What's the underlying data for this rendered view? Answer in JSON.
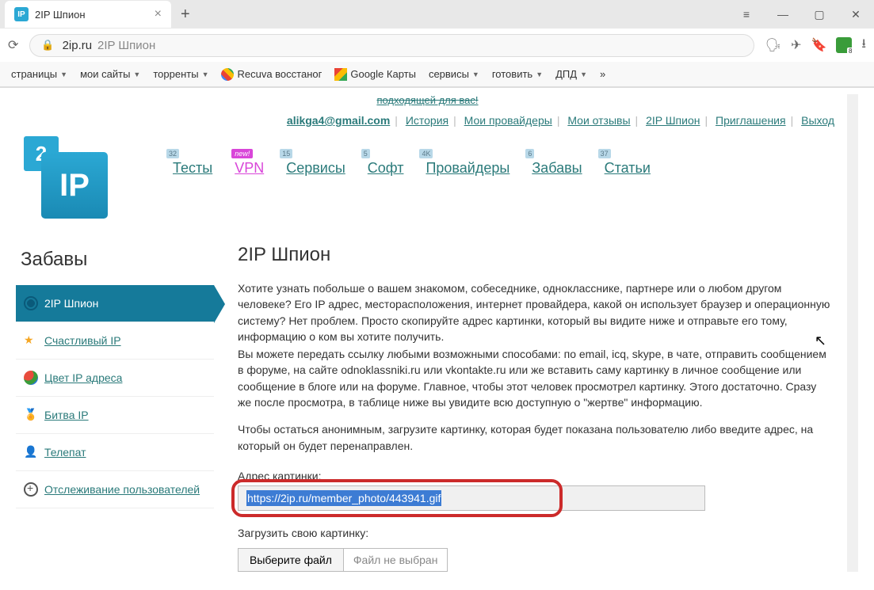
{
  "browser": {
    "tab_title": "2IP Шпион",
    "tab_favicon_text": "IP",
    "url_domain": "2ip.ru",
    "url_path": "2IP Шпион",
    "shield_badge": "8"
  },
  "bookmarks": [
    {
      "label": "страницы",
      "dropdown": true
    },
    {
      "label": "мои сайты",
      "dropdown": true
    },
    {
      "label": "торренты",
      "dropdown": true
    },
    {
      "label": "Recuva восстаног",
      "icon": "google"
    },
    {
      "label": "Google Карты",
      "icon": "maps"
    },
    {
      "label": "сервисы",
      "dropdown": true
    },
    {
      "label": "готовить",
      "dropdown": true
    },
    {
      "label": "ДПД",
      "dropdown": true
    }
  ],
  "top_cut": "подходящей для вас!",
  "user_bar": {
    "email": "alikga4@gmail.com",
    "links": [
      "История",
      "Мои провайдеры",
      "Мои отзывы",
      "2IP Шпион",
      "Приглашения",
      "Выход"
    ]
  },
  "logo": {
    "small": "2",
    "big": "IP"
  },
  "main_nav": [
    {
      "label": "Тесты",
      "badge": "32"
    },
    {
      "label": "VPN",
      "new": "new!"
    },
    {
      "label": "Сервисы",
      "badge": "15"
    },
    {
      "label": "Софт",
      "badge": "5"
    },
    {
      "label": "Провайдеры",
      "badge": "4K"
    },
    {
      "label": "Забавы",
      "badge": "6"
    },
    {
      "label": "Статьи",
      "badge": "37"
    }
  ],
  "sidebar": {
    "title": "Забавы",
    "items": [
      {
        "label": "2IP Шпион",
        "active": true
      },
      {
        "label": "Счастливый IP"
      },
      {
        "label": "Цвет IP адреса"
      },
      {
        "label": "Битва IP"
      },
      {
        "label": "Телепат"
      },
      {
        "label": "Отслеживание пользователей"
      }
    ]
  },
  "main": {
    "title": "2IP Шпион",
    "p1": "Хотите узнать побольше о вашем знакомом, собеседнике, однокласснике, партнере или о любом другом человеке? Его IP адрес, месторасположения, интернет провайдера, какой он использует браузер и операционную систему? Нет проблем. Просто скопируйте адрес картинки, который вы видите ниже и отправьте его тому, информацию о ком вы хотите получить.",
    "p2": "Вы можете передать ссылку любыми возможными способами: по email, icq, skype, в чате, отправить сообщением в форуме, на сайте odnoklassniki.ru или vkontakte.ru или же вставить саму картинку в личное сообщение или сообщение в блоге или на форуме. Главное, чтобы этот человек просмотрел картинку. Этого достаточно. Сразу же после просмотра, в таблице ниже вы увидите всю доступную о \"жертве\" информацию.",
    "p3": "Чтобы остаться анонимным, загрузите картинку, которая будет показана пользователю либо введите адрес, на который он будет перенаправлен.",
    "label_url": "Адрес картинки:",
    "input_url": "https://2ip.ru/member_photo/443941.gif",
    "label_upload": "Загрузить свою картинку:",
    "file_btn": "Выберите файл",
    "file_none": "Файл не выбран"
  }
}
